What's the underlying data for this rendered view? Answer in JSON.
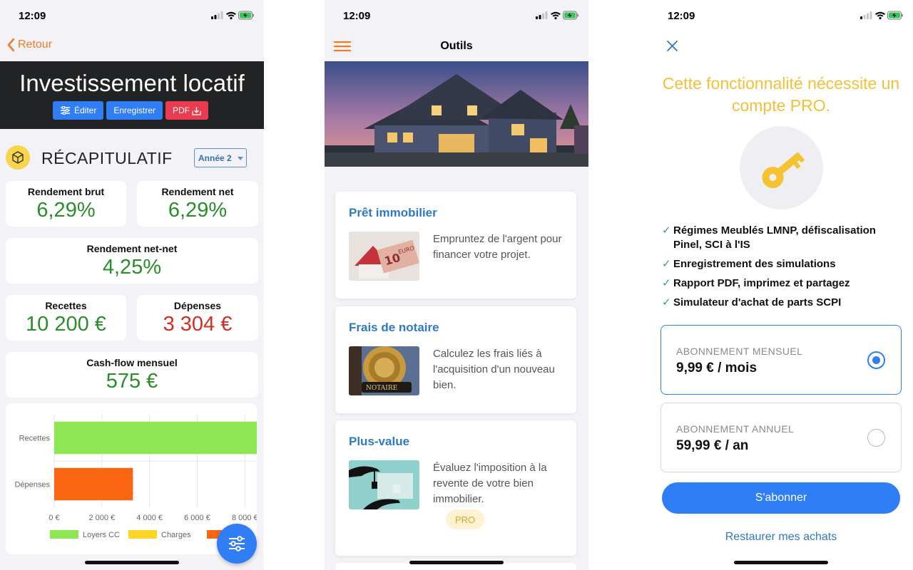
{
  "screens": [
    {
      "status_time": "12:09",
      "back_label": "Retour",
      "header_title": "Investissement locatif",
      "buttons": {
        "edit": "Éditer",
        "save": "Enregistrer",
        "pdf": "PDF"
      },
      "section_title": "RÉCAPITULATIF",
      "year_select": "Année 2",
      "metrics": {
        "gross_yield": {
          "label": "Rendement brut",
          "value": "6,29%"
        },
        "net_yield": {
          "label": "Rendement net",
          "value": "6,29%"
        },
        "net_net_yield": {
          "label": "Rendement net-net",
          "value": "4,25%"
        },
        "income": {
          "label": "Recettes",
          "value": "10 200 €"
        },
        "expenses": {
          "label": "Dépenses",
          "value": "3 304 €"
        },
        "cashflow": {
          "label": "Cash-flow mensuel",
          "value": "575 €"
        }
      },
      "chart_data": {
        "type": "bar",
        "orientation": "horizontal",
        "stacked": true,
        "categories": [
          "Recettes",
          "Dépenses"
        ],
        "series": [
          {
            "name": "Loyers CC",
            "color": "#8ee653",
            "values": [
              10200,
              0
            ]
          },
          {
            "name": "Charges",
            "color": "#fcd526",
            "values": [
              0,
              0
            ]
          },
          {
            "name": "",
            "color": "#fb6612",
            "values": [
              0,
              3304
            ]
          }
        ],
        "xticks": [
          "0 €",
          "2 000 €",
          "4 000 €",
          "6 000 €",
          "8 000 €"
        ],
        "xlim": [
          0,
          8500
        ],
        "grid": true,
        "legend_position": "bottom"
      }
    },
    {
      "status_time": "12:09",
      "title": "Outils",
      "tools": [
        {
          "title": "Prêt immobilier",
          "description": "Empruntez de l'argent pour financer votre projet.",
          "image": "euro-note-house-image"
        },
        {
          "title": "Frais de notaire",
          "description": "Calculez les frais liés à l'acquisition d'un nouveau bien.",
          "image": "notary-seal-image"
        },
        {
          "title": "Plus-value",
          "description": "Évaluez l'imposition à la revente de votre bien immobilier.",
          "image": "keys-hand-image",
          "badge": "PRO"
        }
      ]
    },
    {
      "status_time": "12:09",
      "title": "Cette fonctionnalité nécessite un compte PRO.",
      "features": [
        "Régimes Meublés LMNP, défiscalisation Pinel, SCI à l'IS",
        "Enregistrement des simulations",
        "Rapport PDF, imprimez et partagez",
        "Simulateur d'achat de parts SCPI"
      ],
      "plans": [
        {
          "label": "ABONNEMENT MENSUEL",
          "price": "9,99 € / mois",
          "selected": true
        },
        {
          "label": "ABONNEMENT ANNUEL",
          "price": "59,99 € / an",
          "selected": false
        }
      ],
      "subscribe_label": "S'abonner",
      "restore_label": "Restaurer mes achats"
    }
  ]
}
